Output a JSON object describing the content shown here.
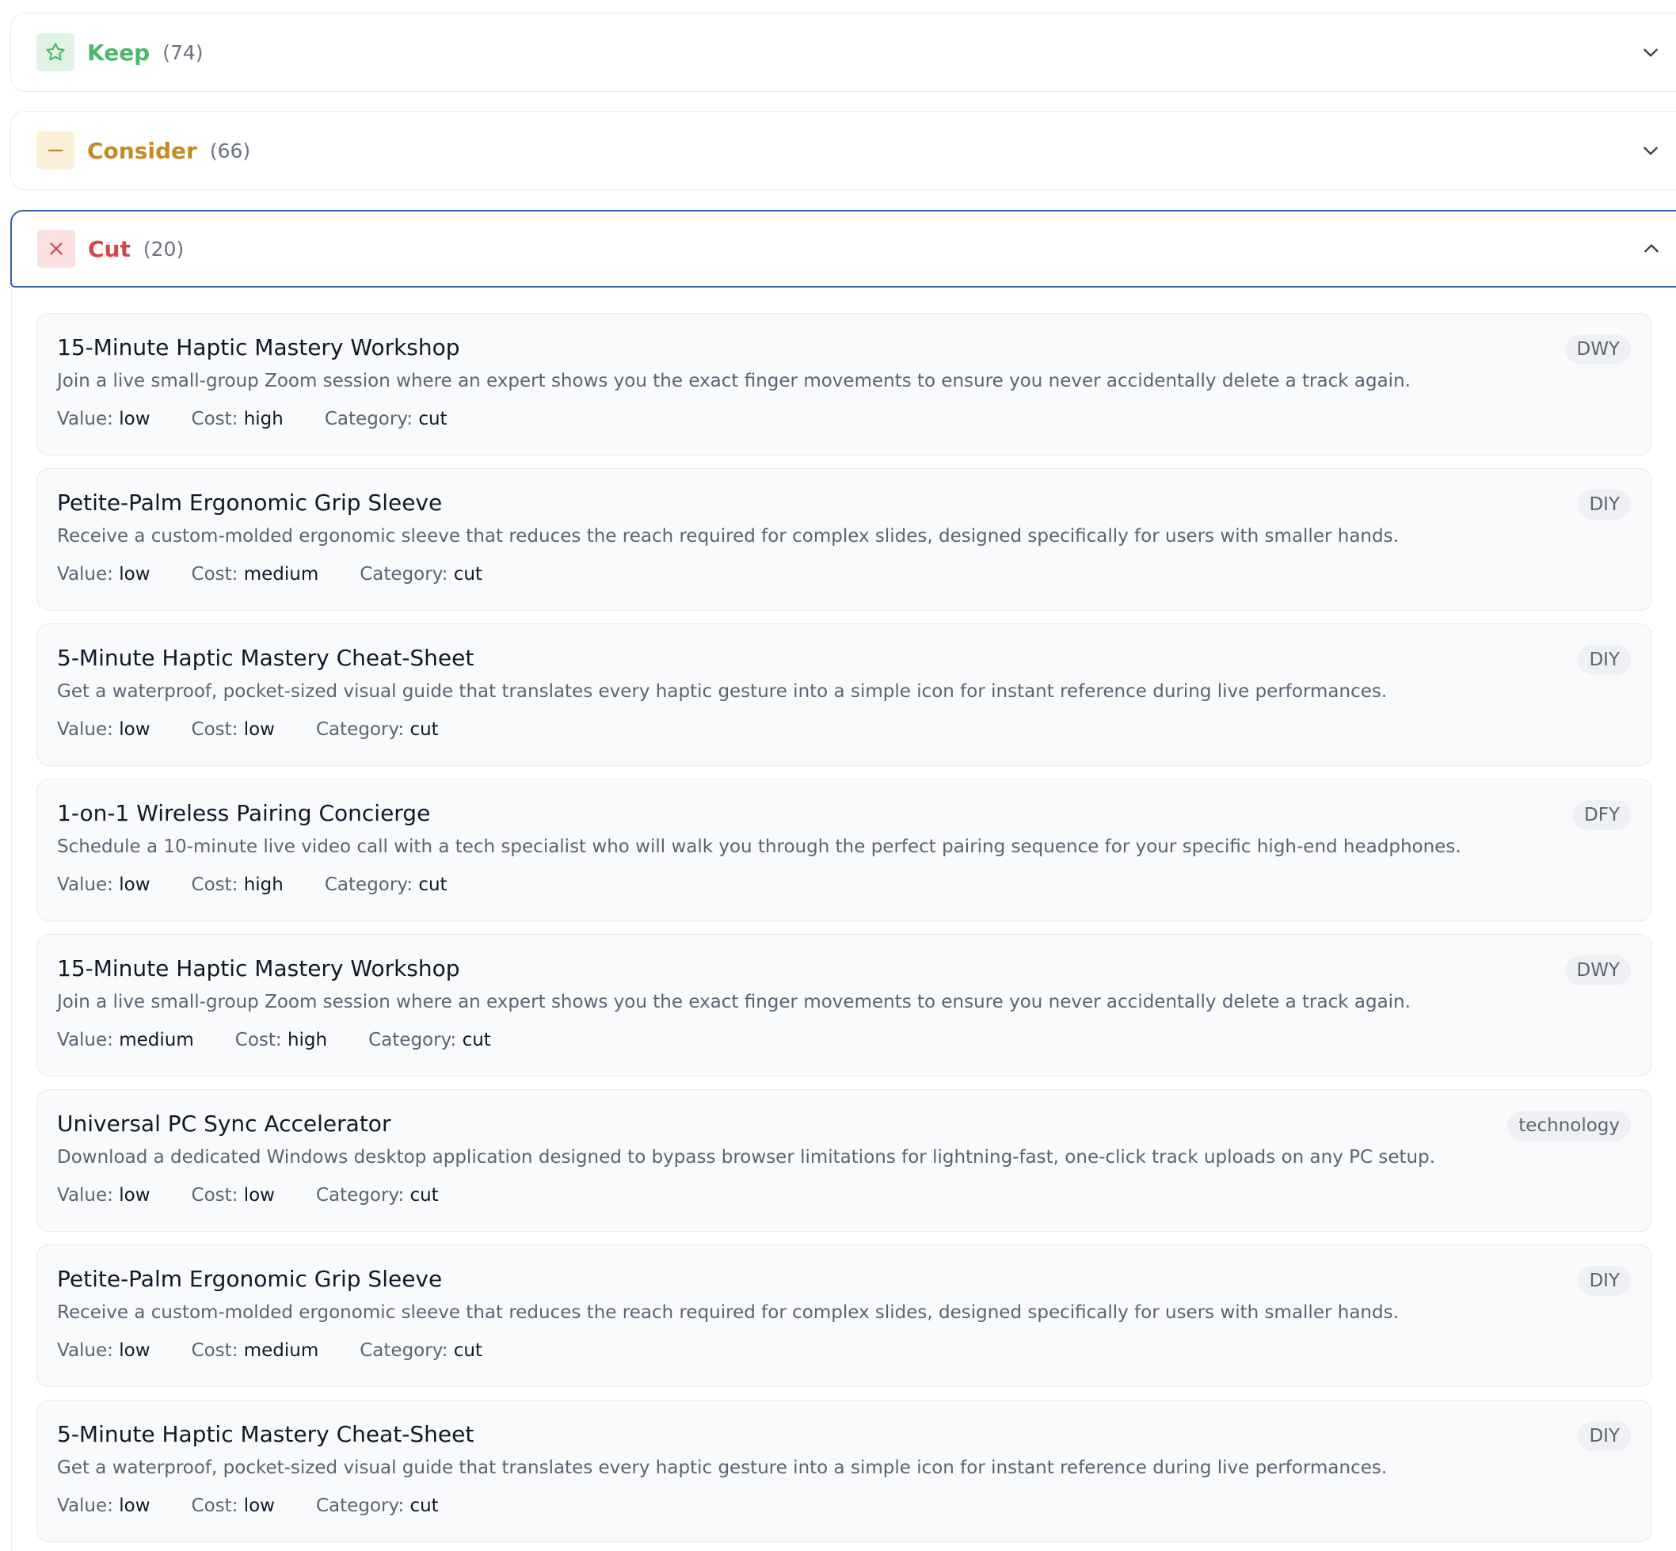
{
  "sections": [
    {
      "title": "Keep",
      "count": "(74)",
      "color": "#4cb86a",
      "icon": "star-icon",
      "expanded": false
    },
    {
      "title": "Consider",
      "count": "(66)",
      "color": "#c48a24",
      "icon": "minus-icon",
      "expanded": false
    },
    {
      "title": "Cut",
      "count": "(20)",
      "color": "#d6454a",
      "icon": "x-icon",
      "expanded": true
    }
  ],
  "meta_labels": {
    "value": "Value:",
    "cost": "Cost:",
    "category": "Category:"
  },
  "items": [
    {
      "title": "15-Minute Haptic Mastery Workshop",
      "tag": "DWY",
      "description": "Join a live small-group Zoom session where an expert shows you the exact finger movements to ensure you never accidentally delete a track again.",
      "value": "low",
      "cost": "high",
      "category": "cut"
    },
    {
      "title": "Petite-Palm Ergonomic Grip Sleeve",
      "tag": "DIY",
      "description": "Receive a custom-molded ergonomic sleeve that reduces the reach required for complex slides, designed specifically for users with smaller hands.",
      "value": "low",
      "cost": "medium",
      "category": "cut"
    },
    {
      "title": "5-Minute Haptic Mastery Cheat-Sheet",
      "tag": "DIY",
      "description": "Get a waterproof, pocket-sized visual guide that translates every haptic gesture into a simple icon for instant reference during live performances.",
      "value": "low",
      "cost": "low",
      "category": "cut"
    },
    {
      "title": "1-on-1 Wireless Pairing Concierge",
      "tag": "DFY",
      "description": "Schedule a 10-minute live video call with a tech specialist who will walk you through the perfect pairing sequence for your specific high-end headphones.",
      "value": "low",
      "cost": "high",
      "category": "cut"
    },
    {
      "title": "15-Minute Haptic Mastery Workshop",
      "tag": "DWY",
      "description": "Join a live small-group Zoom session where an expert shows you the exact finger movements to ensure you never accidentally delete a track again.",
      "value": "medium",
      "cost": "high",
      "category": "cut"
    },
    {
      "title": "Universal PC Sync Accelerator",
      "tag": "technology",
      "description": "Download a dedicated Windows desktop application designed to bypass browser limitations for lightning-fast, one-click track uploads on any PC setup.",
      "value": "low",
      "cost": "low",
      "category": "cut"
    },
    {
      "title": "Petite-Palm Ergonomic Grip Sleeve",
      "tag": "DIY",
      "description": "Receive a custom-molded ergonomic sleeve that reduces the reach required for complex slides, designed specifically for users with smaller hands.",
      "value": "low",
      "cost": "medium",
      "category": "cut"
    },
    {
      "title": "5-Minute Haptic Mastery Cheat-Sheet",
      "tag": "DIY",
      "description": "Get a waterproof, pocket-sized visual guide that translates every haptic gesture into a simple icon for instant reference during live performances.",
      "value": "low",
      "cost": "low",
      "category": "cut"
    }
  ]
}
